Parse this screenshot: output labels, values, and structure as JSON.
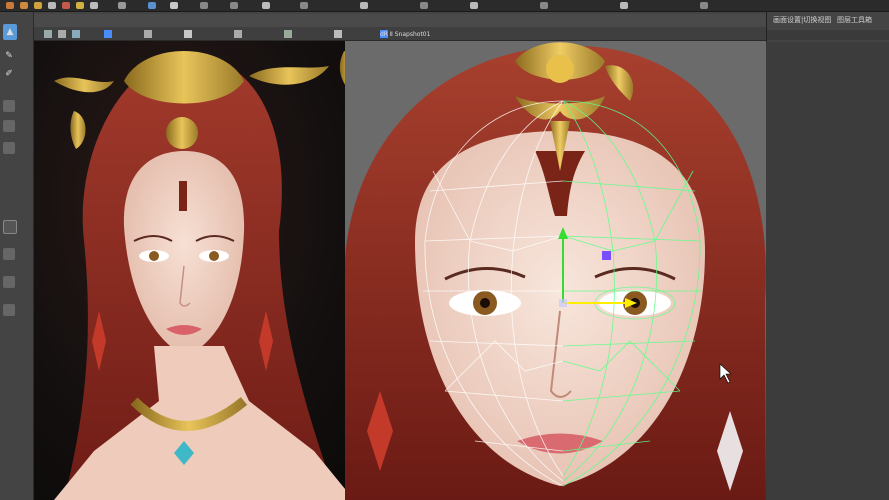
{
  "viewport_panel": {
    "menu_label": "dR  Ⅱ  Snapshot01"
  },
  "right_panel": {
    "tab_1": "画面设置|切换视图",
    "tab_2": "图层工具箱"
  },
  "colors": {
    "hair": "#8a2a22",
    "skin": "#f2d6c8",
    "gold": "#c9a23a",
    "wireframe_white": "#ffffff",
    "wireframe_green": "#5cff8a",
    "gizmo_yellow": "#ffee00",
    "gizmo_purple": "#7a4dff",
    "viewport_bg": "#6b6b6b"
  },
  "icons": {
    "top_toolbar": [
      "file-icon",
      "undo-icon",
      "redo-icon",
      "select-icon",
      "move-icon",
      "rotate-icon",
      "scale-icon",
      "snap-icon",
      "render-icon",
      "settings-icon"
    ],
    "left_tools": [
      "select-arrow-icon",
      "paint-icon",
      "brush-icon",
      "layer-icon",
      "object-icon",
      "component-icon",
      "tool-settings-icon",
      "grid-icon",
      "outliner-icon"
    ]
  }
}
